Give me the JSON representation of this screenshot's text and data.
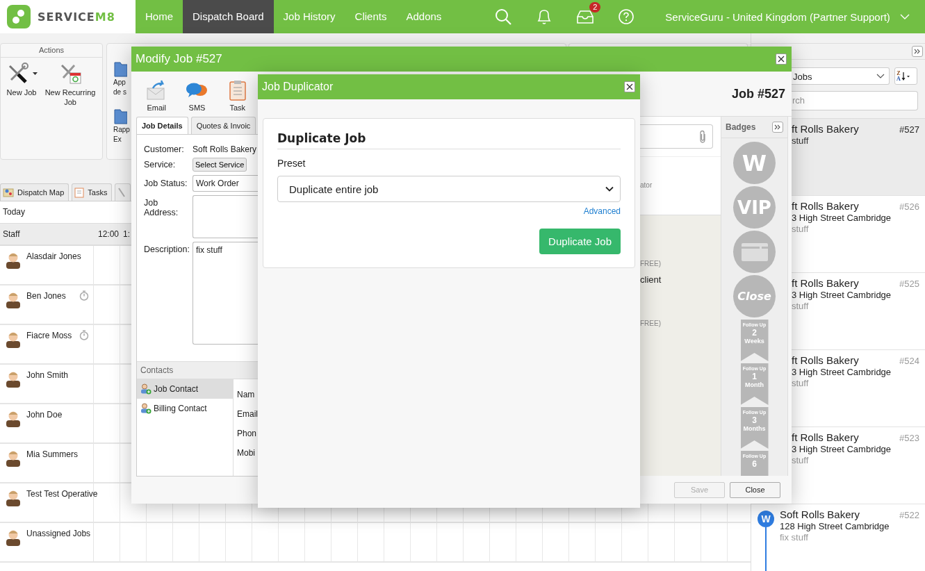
{
  "nav": {
    "brand": "SERVICE",
    "brand_suffix": "M8",
    "items": [
      {
        "label": "Home",
        "selected": false
      },
      {
        "label": "Dispatch Board",
        "selected": true
      },
      {
        "label": "Job History",
        "selected": false
      },
      {
        "label": "Clients",
        "selected": false
      },
      {
        "label": "Addons",
        "selected": false
      }
    ],
    "inbox_count": "2",
    "account": "ServiceGuru - United Kingdom (Partner Support)"
  },
  "actions_panel": {
    "title": "Actions",
    "items": [
      {
        "label": "New Job",
        "dropdown": true
      },
      {
        "label": "New Recurring Job",
        "dropdown": false
      }
    ]
  },
  "reports_panel": {
    "items": [
      {
        "lines": [
          "App",
          "de s"
        ]
      },
      {
        "lines": [
          "Rapp",
          "Ex"
        ]
      }
    ]
  },
  "view_tabs": [
    {
      "kind": "map",
      "label": "Dispatch Map",
      "selected": false
    },
    {
      "kind": "tasks",
      "label": "Tasks",
      "selected": false
    },
    {
      "kind": "tools",
      "selected": false
    }
  ],
  "day_label": "Today",
  "staff_header": {
    "title": "Staff",
    "times": [
      "12:00",
      "1:"
    ]
  },
  "staff": [
    {
      "name": "Alasdair Jones",
      "timer": false
    },
    {
      "name": "Ben Jones",
      "timer": true
    },
    {
      "name": "Fiacre Moss",
      "timer": true
    },
    {
      "name": "John Smith",
      "timer": false
    },
    {
      "name": "John Doe",
      "timer": false
    },
    {
      "name": "Mia Summers",
      "timer": false
    },
    {
      "name": "Test Test Operative",
      "timer": false
    },
    {
      "name": "Unassigned Jobs",
      "timer": false
    }
  ],
  "modify_job": {
    "title": "Modify Job #527",
    "toolbar": [
      {
        "kind": "email",
        "label": "Email"
      },
      {
        "kind": "sms",
        "label": "SMS"
      },
      {
        "kind": "task",
        "label": "Task"
      }
    ],
    "job_number": "Job #527",
    "tabs": [
      {
        "label": "Job Details",
        "selected": true
      },
      {
        "label": "Quotes & Invoic",
        "selected": false
      }
    ],
    "fields": [
      {
        "kind": "text",
        "label": "Customer:",
        "value": "Soft Rolls Bakery"
      },
      {
        "kind": "button",
        "label": "Service:",
        "value": "Select Service"
      },
      {
        "kind": "select",
        "label": "Job Status:",
        "value": "Work Order"
      },
      {
        "kind": "textarea",
        "label": "Job Address:"
      },
      {
        "kind": "textarea",
        "label": "Description:",
        "value": "fix stuff"
      }
    ],
    "contacts": {
      "title": "Contacts",
      "items": [
        {
          "label": "Job Contact",
          "selected": true
        },
        {
          "label": "Billing Contact",
          "selected": false
        }
      ],
      "fields": [
        "Nam",
        "Email",
        "Phon",
        "Mobi"
      ]
    },
    "side_texts": [
      {
        "kind": "meta",
        "text": "ator"
      },
      {
        "kind": "meta",
        "text": "FREE)"
      },
      {
        "kind": "line",
        "text": "client"
      },
      {
        "kind": "meta",
        "text": "FREE)"
      }
    ],
    "badges": {
      "title": "Badges",
      "items": [
        {
          "kind": "letter",
          "text": "W"
        },
        {
          "kind": "letter",
          "text": "VIP"
        },
        {
          "kind": "card"
        },
        {
          "kind": "stamp",
          "text": "Close"
        },
        {
          "kind": "ribbon",
          "lines": [
            "Follow Up",
            "2",
            "Weeks"
          ]
        },
        {
          "kind": "ribbon",
          "lines": [
            "Follow Up",
            "1",
            "Month"
          ]
        },
        {
          "kind": "ribbon",
          "lines": [
            "Follow Up",
            "3",
            "Months"
          ]
        },
        {
          "kind": "ribbon",
          "lines": [
            "Follow Up",
            "6"
          ]
        }
      ]
    },
    "buttons": [
      {
        "label": "Save",
        "disabled": true
      },
      {
        "label": "Close",
        "disabled": false
      }
    ]
  },
  "job_duplicator": {
    "title": "Job Duplicator",
    "heading": "Duplicate Job",
    "preset_label": "Preset",
    "preset_value": "Duplicate entire job",
    "advanced_link": "Advanced",
    "submit": "Duplicate Job"
  },
  "jobs_panel": {
    "filter": "Jobs",
    "sort_letters": [
      "Z",
      "A"
    ],
    "search_placeholder": "rch",
    "jobs": [
      {
        "kind": "covered",
        "number": "#527",
        "name": "ft Rolls Bakery",
        "description": "stuff",
        "selected": true
      },
      {
        "kind": "covered",
        "number": "#526",
        "name": "ft Rolls Bakery",
        "address": "3 High Street Cambridge",
        "description": "stuff",
        "selected": false
      },
      {
        "kind": "covered",
        "number": "#525",
        "name": "ft Rolls Bakery",
        "address": "3 High Street Cambridge",
        "description": "stuff",
        "selected": false
      },
      {
        "kind": "covered",
        "number": "#524",
        "name": "ft Rolls Bakery",
        "address": "3 High Street Cambridge",
        "description": "stuff",
        "selected": false
      },
      {
        "kind": "covered",
        "number": "#523",
        "name": "ft Rolls Bakery",
        "address": "3 High Street Cambridge",
        "description": "stuff",
        "selected": false
      },
      {
        "kind": "full",
        "number": "#522",
        "name": "Soft Rolls Bakery",
        "address": "128 High Street Cambridge",
        "description": "fix stuff",
        "badge": "W",
        "selected": false
      }
    ]
  }
}
